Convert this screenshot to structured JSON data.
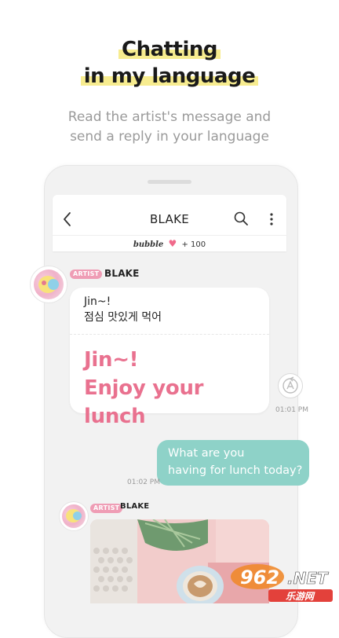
{
  "headline": {
    "line1": "Chatting",
    "line2": "in my language"
  },
  "subtitle": {
    "line1": "Read the artist's message and",
    "line2": "send a reply in your language"
  },
  "chat": {
    "title": "BLAKE",
    "bubble_word": "bubble",
    "bubble_count": "+ 100",
    "messages": [
      {
        "tag": "ARTIST",
        "name": "BLAKE",
        "original_line1": "Jin~!",
        "original_line2": "점심 맛있게 먹어",
        "translated_line1": "Jin~!",
        "translated_line2": "Enjoy your lunch",
        "time": "01:01 PM"
      },
      {
        "tag": "ARTIST",
        "name": "BLAKE"
      }
    ],
    "reply": {
      "line1": "What are you",
      "line2": "having for lunch today?",
      "time": "01:02 PM"
    }
  },
  "watermark": {
    "brand": "962",
    "suffix": ".NET",
    "sub": "乐游网"
  },
  "colors": {
    "accent_pink": "#e9718f",
    "reply_teal": "#8ed2c8",
    "highlight_yellow": "#f7ec8f",
    "tag_pink": "#ef9db5"
  },
  "icons": {
    "back": "chevron-left-icon",
    "search": "search-icon",
    "more": "more-vertical-icon",
    "heart": "heart-icon",
    "translate": "translate-icon"
  }
}
